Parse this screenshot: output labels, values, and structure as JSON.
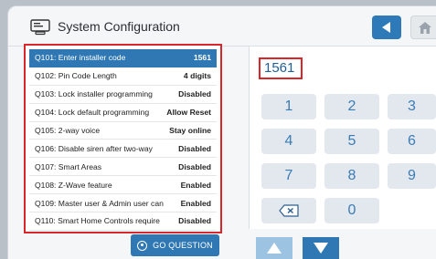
{
  "header": {
    "title": "System Configuration",
    "back_icon": "back-arrow-icon",
    "home_icon": "home-icon"
  },
  "questions": [
    {
      "label": "Q101: Enter installer code",
      "value": "1561",
      "selected": true
    },
    {
      "label": "Q102: Pin Code Length",
      "value": "4 digits"
    },
    {
      "label": "Q103: Lock installer programming",
      "value": "Disabled"
    },
    {
      "label": "Q104: Lock default programming",
      "value": "Allow Reset"
    },
    {
      "label": "Q105: 2-way voice",
      "value": "Stay online"
    },
    {
      "label": "Q106: Disable siren after two-way",
      "value": "Disabled"
    },
    {
      "label": "Q107: Smart Areas",
      "value": "Disabled"
    },
    {
      "label": "Q108: Z-Wave feature",
      "value": "Enabled"
    },
    {
      "label": "Q109: Master user & Admin user can",
      "value": "Enabled"
    },
    {
      "label": "Q110: Smart Home Controls require",
      "value": "Disabled"
    }
  ],
  "go_question": {
    "label": "GO QUESTION"
  },
  "keypad": {
    "display_value": "1561",
    "keys": [
      "1",
      "2",
      "3",
      "4",
      "5",
      "6",
      "7",
      "8",
      "9",
      "0"
    ]
  },
  "colors": {
    "accent": "#2f78b3",
    "highlight": "#d8262a"
  }
}
